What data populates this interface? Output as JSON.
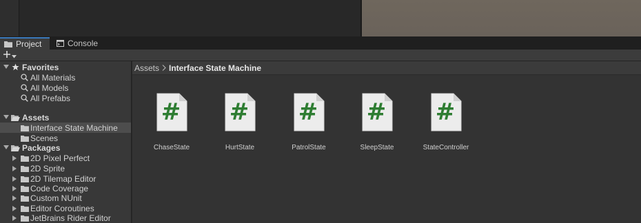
{
  "tabs": [
    {
      "label": "Project",
      "icon": "folder-icon",
      "active": true
    },
    {
      "label": "Console",
      "icon": "console-icon",
      "active": false
    }
  ],
  "toolbar": {
    "add_label": "+"
  },
  "favorites": {
    "label": "Favorites",
    "items": [
      "All Materials",
      "All Models",
      "All Prefabs"
    ]
  },
  "assets": {
    "label": "Assets",
    "items": [
      "Interface State Machine",
      "Scenes"
    ],
    "selected": "Interface State Machine"
  },
  "packages": {
    "label": "Packages",
    "items": [
      "2D Pixel Perfect",
      "2D Sprite",
      "2D Tilemap Editor",
      "Code Coverage",
      "Custom NUnit",
      "Editor Coroutines",
      "JetBrains Rider Editor"
    ]
  },
  "breadcrumb": {
    "root": "Assets",
    "separator": ">",
    "current": "Interface State Machine"
  },
  "files": [
    {
      "name": "ChaseState",
      "icon": "csharp-script-icon",
      "glyph": "#"
    },
    {
      "name": "HurtState",
      "icon": "csharp-script-icon",
      "glyph": "#"
    },
    {
      "name": "PatrolState",
      "icon": "csharp-script-icon",
      "glyph": "#"
    },
    {
      "name": "SleepState",
      "icon": "csharp-script-icon",
      "glyph": "#"
    },
    {
      "name": "StateController",
      "icon": "csharp-script-icon",
      "glyph": "#"
    }
  ],
  "colors": {
    "accent": "#3a79bb",
    "script_hash": "#2e7d32",
    "selection": "#4d4d4d"
  }
}
